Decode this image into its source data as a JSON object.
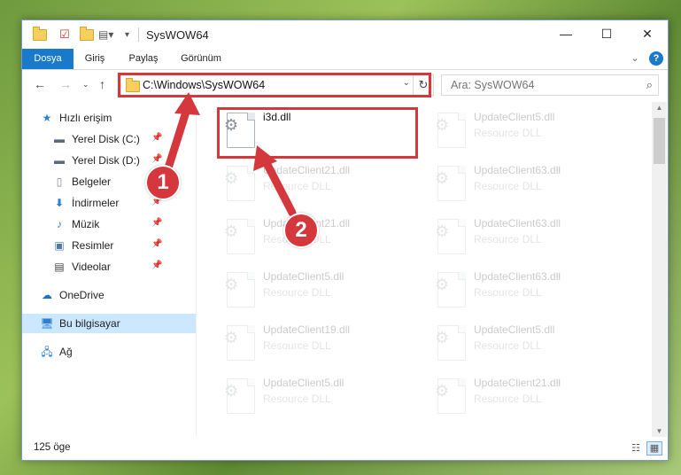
{
  "window": {
    "title": "SysWOW64",
    "minimize": "—",
    "maximize": "☐",
    "close": "✕"
  },
  "ribbon": {
    "tabs": [
      {
        "label": "Dosya"
      },
      {
        "label": "Giriş"
      },
      {
        "label": "Paylaş"
      },
      {
        "label": "Görünüm"
      }
    ],
    "expand_icon": "⌄",
    "help_icon": "?"
  },
  "nav": {
    "address": "C:\\Windows\\SysWOW64",
    "search_placeholder": "Ara: SysWOW64"
  },
  "sidebar": {
    "items": [
      {
        "label": "Hızlı erişim"
      },
      {
        "label": "Yerel Disk (C:)"
      },
      {
        "label": "Yerel Disk (D:)"
      },
      {
        "label": "Belgeler"
      },
      {
        "label": "İndirmeler"
      },
      {
        "label": "Müzik"
      },
      {
        "label": "Resimler"
      },
      {
        "label": "Videolar"
      },
      {
        "label": "OneDrive"
      },
      {
        "label": "Bu bilgisayar"
      },
      {
        "label": "Ağ"
      }
    ]
  },
  "files": [
    {
      "name": "i3d.dll",
      "desc": ""
    },
    {
      "name": "UpdateClient5.dll",
      "desc": "Resource DLL"
    },
    {
      "name": "UpdateClient21.dll",
      "desc": "Resource DLL"
    },
    {
      "name": "UpdateClient63.dll",
      "desc": "Resource DLL"
    },
    {
      "name": "UpdateClient21.dll",
      "desc": "Resource DLL"
    },
    {
      "name": "UpdateClient63.dll",
      "desc": "Resource DLL"
    },
    {
      "name": "UpdateClient5.dll",
      "desc": "Resource DLL"
    },
    {
      "name": "UpdateClient63.dll",
      "desc": "Resource DLL"
    },
    {
      "name": "UpdateClient19.dll",
      "desc": "Resource DLL"
    },
    {
      "name": "UpdateClient5.dll",
      "desc": "Resource DLL"
    },
    {
      "name": "UpdateClient5.dll",
      "desc": "Resource DLL"
    },
    {
      "name": "UpdateClient21.dll",
      "desc": "Resource DLL"
    }
  ],
  "status": {
    "count": "125 öge"
  },
  "annotations": {
    "badge1": "1",
    "badge2": "2",
    "color": "#d5383c"
  },
  "colors": {
    "accent": "#1979ca",
    "selected_bg": "#cce8ff"
  }
}
